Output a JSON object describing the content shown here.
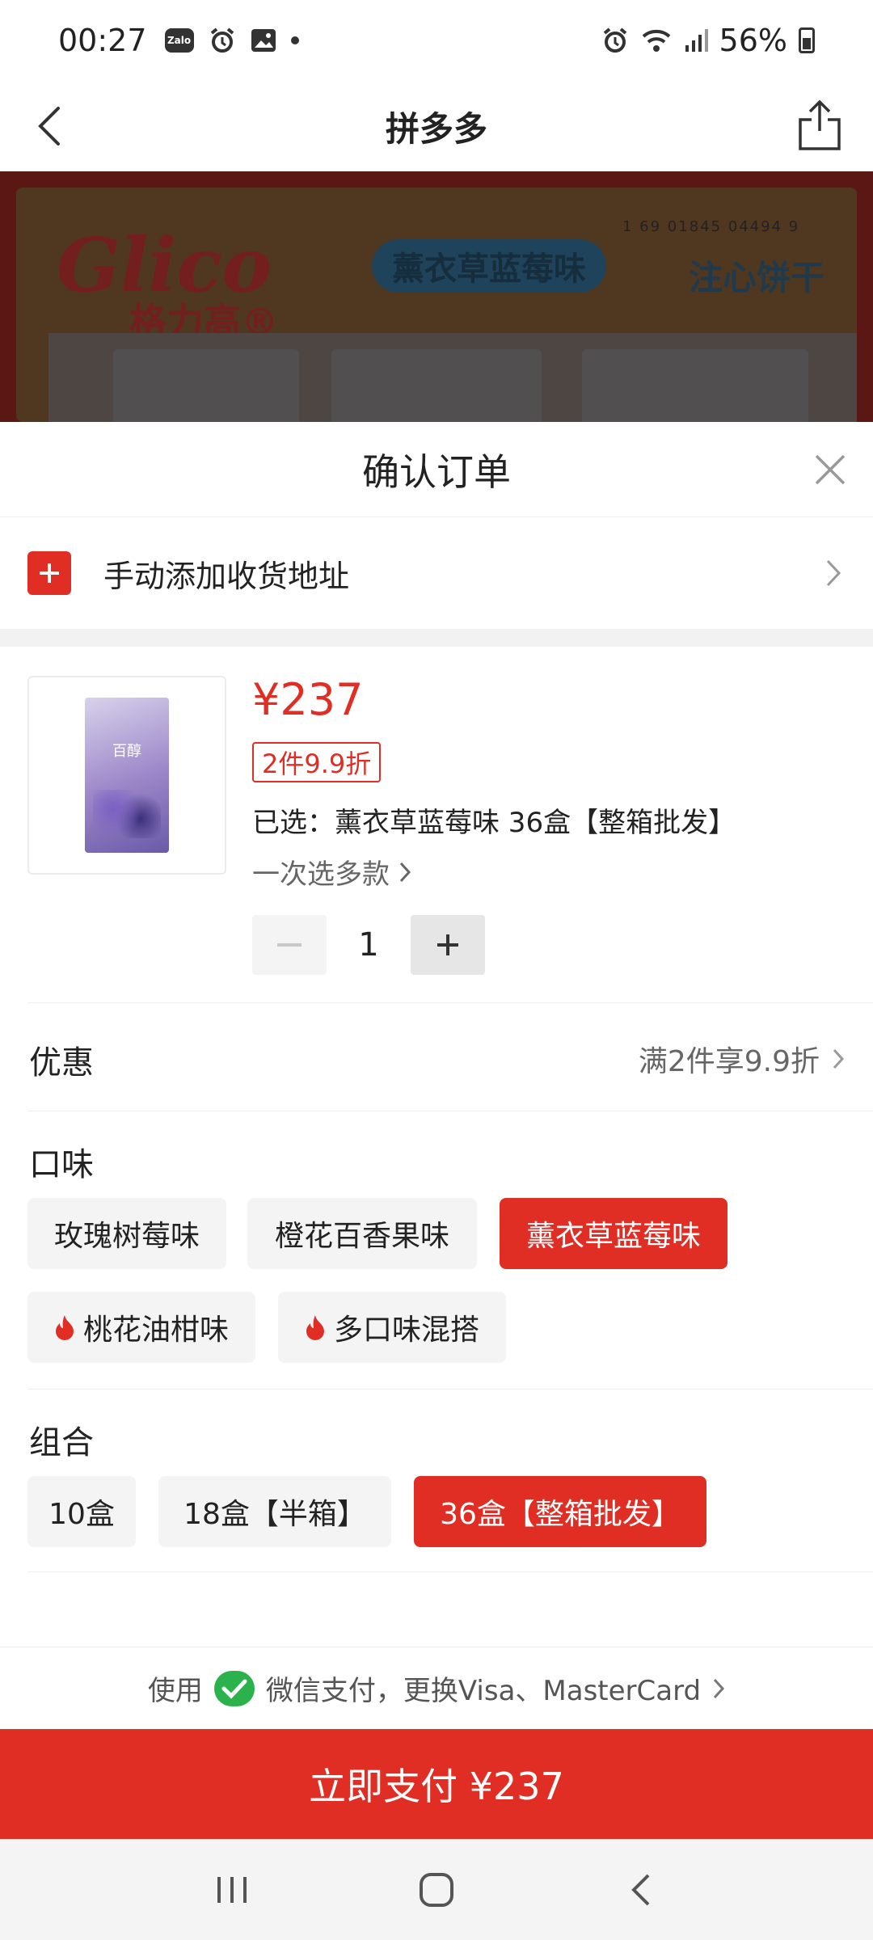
{
  "status_bar": {
    "time": "00:27",
    "zalo_label": "Zalo",
    "battery": "56%"
  },
  "header": {
    "title": "拼多多"
  },
  "banner": {
    "brand": "Glico",
    "brand_cn": "格力高®",
    "flavor_pill": "薰衣草蓝莓味",
    "tagline": "注心饼干",
    "barcode": "1 69 01845 04494 9"
  },
  "sheet": {
    "title": "确认订单",
    "address": {
      "label": "手动添加收货地址"
    },
    "product": {
      "thumb_label": "百醇",
      "price": "¥237",
      "promo": "2件9.9折",
      "selected": "已选：薰衣草蓝莓味 36盒【整箱批发】",
      "multi_select": "一次选多款",
      "quantity": "1"
    },
    "discount": {
      "label": "优惠",
      "value": "满2件享9.9折"
    },
    "flavor": {
      "label": "口味",
      "options": [
        "玫瑰树莓味",
        "橙花百香果味",
        "薰衣草蓝莓味",
        "桃花油柑味",
        "多口味混搭"
      ],
      "selected": "薰衣草蓝莓味"
    },
    "combo": {
      "label": "组合",
      "options": [
        "10盒",
        "18盒【半箱】",
        "36盒【整箱批发】"
      ],
      "selected": "36盒【整箱批发】"
    },
    "payment": {
      "prefix": "使用",
      "text": "微信支付，更换Visa、MasterCard"
    },
    "pay_button": "立即支付 ¥237"
  },
  "colors": {
    "accent": "#e02e24",
    "wechat": "#2bb24c"
  }
}
